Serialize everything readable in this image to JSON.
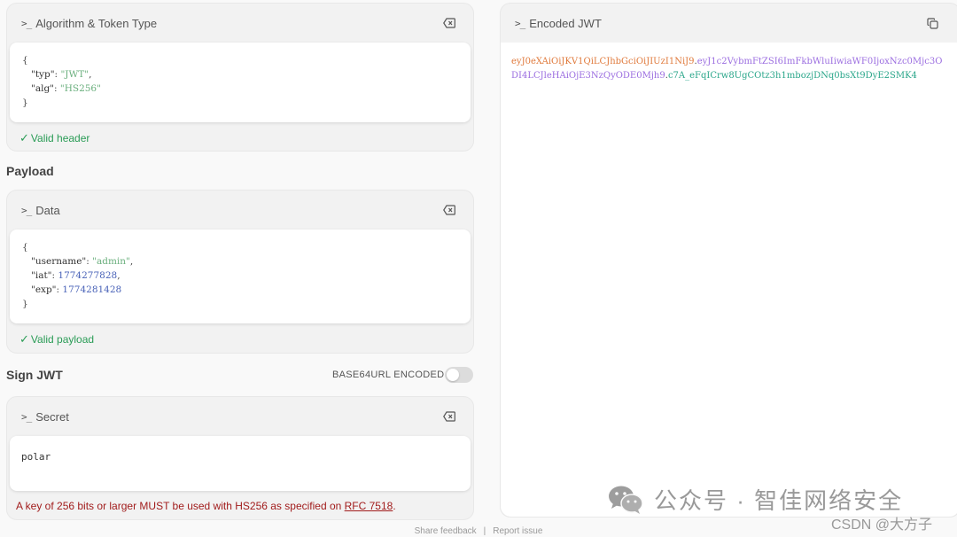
{
  "header_panel": {
    "title": "Algorithm & Token Type",
    "valid_text": "Valid header",
    "code": {
      "open": "{",
      "close": "}",
      "typ_key": "\"typ\"",
      "typ_val": "\"JWT\"",
      "alg_key": "\"alg\"",
      "alg_val": "\"HS256\""
    }
  },
  "payload_section": {
    "title": "Payload",
    "panel_title": "Data",
    "valid_text": "Valid payload",
    "code": {
      "open": "{",
      "close": "}",
      "username_key": "\"username\"",
      "username_val": "\"admin\"",
      "iat_key": "\"iat\"",
      "iat_val": "1774277828",
      "exp_key": "\"exp\"",
      "exp_val": "1774281428"
    }
  },
  "sign_section": {
    "title": "Sign JWT",
    "toggle_label": "BASE64URL ENCODED",
    "toggle_on": false,
    "panel_title": "Secret",
    "secret_value": "polar",
    "warning_prefix": "A key of 256 bits or larger MUST be used with HS256 as specified on ",
    "warning_link": "RFC 7518",
    "warning_suffix": "."
  },
  "encoded_panel": {
    "title": "Encoded JWT",
    "header_part": "eyJ0eXAiOiJKV1QiLCJhbGciOiJIUzI1NiJ9",
    "payload_part": "eyJ1c2VybmFtZSI6ImFkbWluIiwiaWF0IjoxNzc0Mjc3ODI4LCJleHAiOjE3NzQyODE0Mjh9",
    "signature_part": "c7A_eFqICrw8UgCOtz3h1mbozjDNq0bsXt9DyE2SMK4",
    "separator": "."
  },
  "footer": {
    "share_feedback": "Share feedback",
    "divider": "|",
    "report_issue": "Report issue"
  },
  "watermark": {
    "text": "公众号 · 智佳网络安全",
    "csdn": "CSDN @大方子"
  },
  "colors": {
    "header_token": "#e07a3c",
    "payload_token": "#9b6de0",
    "signature_token": "#2aa68a",
    "valid": "#2a9c56",
    "warning": "#a11c1c"
  }
}
